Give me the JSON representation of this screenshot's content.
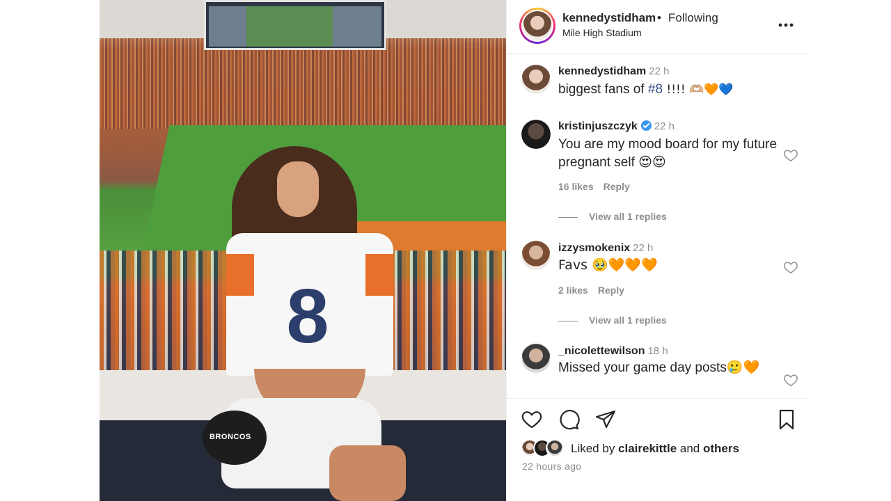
{
  "post": {
    "author": "kennedystidham",
    "separator": "•",
    "follow_status": "Following",
    "location": "Mile High Stadium",
    "photo_text": {
      "jersey_number": "8",
      "ball_text": "BRONCOS"
    }
  },
  "comments": [
    {
      "user": "kennedystidham",
      "time": "22 h",
      "text_prefix": "biggest fans of ",
      "hashtag": "#8",
      "text_suffix": " !!!! 🫶🏼🧡💙",
      "verified": false
    },
    {
      "user": "kristinjuszczyk",
      "time": "22 h",
      "text": "You are my mood board for my future pregnant self 😍😍",
      "likes": "16 likes",
      "reply_label": "Reply",
      "view_replies": "View all 1 replies",
      "verified": true
    },
    {
      "user": "izzysmokenix",
      "time": "22 h",
      "text": "Favs 🥹🧡🧡🧡",
      "likes": "2 likes",
      "reply_label": "Reply",
      "view_replies": "View all 1 replies",
      "verified": false
    },
    {
      "user": "_nicolettewilson",
      "time": "18 h",
      "text": "Missed your game day posts🥲🧡",
      "verified": false
    }
  ],
  "footer": {
    "liked_by_prefix": "Liked by ",
    "liked_by_user": "clairekittle",
    "liked_by_mid": " and ",
    "liked_by_others": "others",
    "timestamp": "22 hours ago"
  },
  "icons": [
    "more-icon",
    "heart-icon",
    "comment-icon",
    "share-icon",
    "bookmark-icon",
    "verified-icon"
  ],
  "colors": {
    "link": "#385185",
    "secondary_text": "#8e8e8e",
    "verified": "#3897f0",
    "primary_text": "#262626"
  }
}
